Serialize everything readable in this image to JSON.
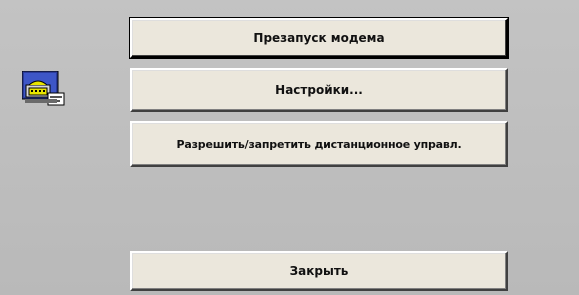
{
  "dialog": {
    "buttons": {
      "restart_modem": "Презапуск модема",
      "settings": "Настройки...",
      "remote_control": "Разрешить/запретить дистанционное управл.",
      "close": "Закрыть"
    },
    "icon": "modem-phone-icon"
  }
}
